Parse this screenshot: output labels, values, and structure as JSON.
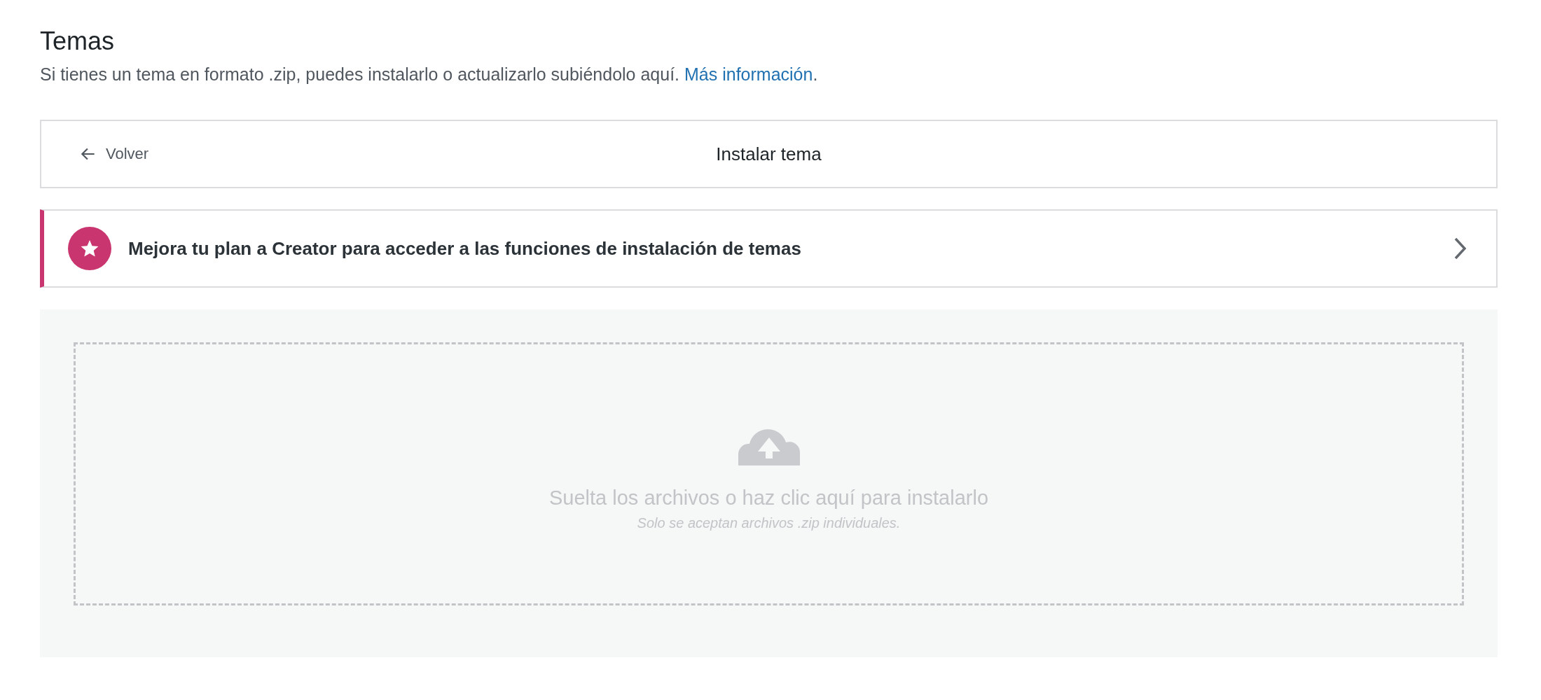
{
  "page": {
    "title": "Temas",
    "description": "Si tienes un tema en formato .zip, puedes instalarlo o actualizarlo subiéndolo aquí.",
    "link": "Más información",
    "link_suffix": "."
  },
  "header_card": {
    "back_label": "Volver",
    "title": "Instalar tema"
  },
  "upgrade_banner": {
    "text": "Mejora tu plan a Creator para acceder a las funciones de instalación de temas"
  },
  "dropzone": {
    "label": "Suelta los archivos o haz clic aquí para instalarlo",
    "hint": "Solo se aceptan archivos .zip individuales."
  }
}
